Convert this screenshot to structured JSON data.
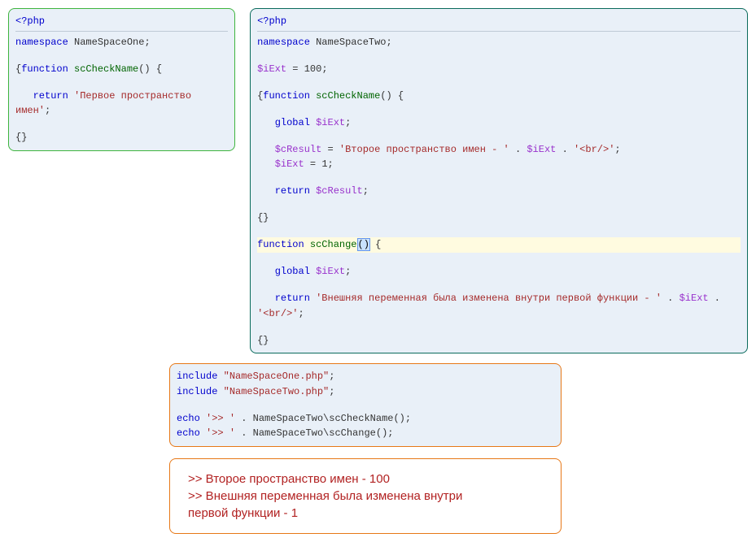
{
  "panel1": {
    "php_tag": "<?php",
    "ns_kw": "namespace",
    "ns_name": "NameSpaceOne",
    "fn_kw": "function",
    "fn_name": "scCheckName",
    "ret_kw": "return",
    "ret_str": "'Первое пространство имен'"
  },
  "panel2": {
    "php_tag": "<?php",
    "ns_kw": "namespace",
    "ns_name": "NameSpaceTwo",
    "ext_var": "$iExt",
    "ext_val": "100",
    "fn_kw": "function",
    "fn1_name": "scCheckName",
    "global_kw": "global",
    "cresult_var": "$cResult",
    "cresult_str1": "'Второе пространство имен - '",
    "cresult_str2": "'<br/>'",
    "iext_assign_val": "1",
    "ret_kw": "return",
    "fn2_name": "scChange",
    "fn2_ret_str1": "'Внешняя переменная была изменена внутри первой функции - '",
    "fn2_ret_str2": "'<br/>'"
  },
  "panel3": {
    "include_kw": "include",
    "inc1": "\"NameSpaceOne.php\"",
    "inc2": "\"NameSpaceTwo.php\"",
    "echo_kw": "echo",
    "echo_prefix": "'>> '",
    "call1": "NameSpaceTwo\\scCheckName()",
    "call2": "NameSpaceTwo\\scChange()"
  },
  "output": {
    "line1": ">> Второе пространство имен - 100",
    "line2a": ">> Внешняя переменная была изменена внутри",
    "line2b": "первой функции - 1"
  }
}
